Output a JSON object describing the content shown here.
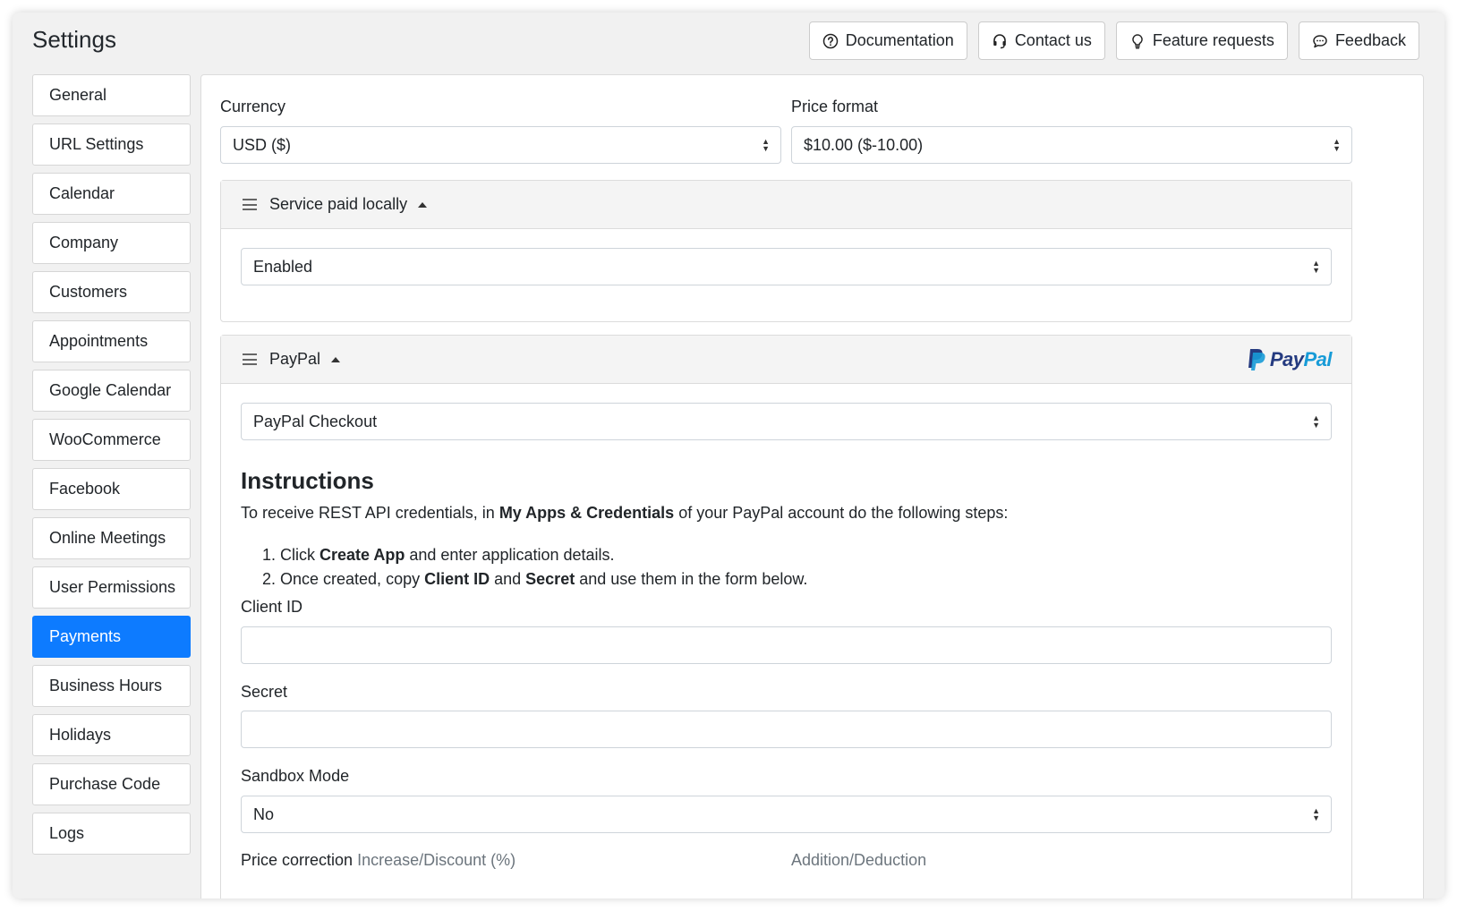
{
  "header": {
    "title": "Settings"
  },
  "top_buttons": [
    {
      "label": "Documentation",
      "icon": "question-circle-icon"
    },
    {
      "label": "Contact us",
      "icon": "headset-icon"
    },
    {
      "label": "Feature requests",
      "icon": "lightbulb-icon"
    },
    {
      "label": "Feedback",
      "icon": "chat-icon"
    }
  ],
  "sidebar": {
    "items": [
      {
        "label": "General"
      },
      {
        "label": "URL Settings"
      },
      {
        "label": "Calendar"
      },
      {
        "label": "Company"
      },
      {
        "label": "Customers"
      },
      {
        "label": "Appointments"
      },
      {
        "label": "Google Calendar"
      },
      {
        "label": "WooCommerce"
      },
      {
        "label": "Facebook"
      },
      {
        "label": "Online Meetings"
      },
      {
        "label": "User Permissions"
      },
      {
        "label": "Payments",
        "active": true
      },
      {
        "label": "Business Hours"
      },
      {
        "label": "Holidays"
      },
      {
        "label": "Purchase Code"
      },
      {
        "label": "Logs"
      }
    ]
  },
  "payments": {
    "currency": {
      "label": "Currency",
      "value": "USD ($)"
    },
    "price_format": {
      "label": "Price format",
      "value": "$10.00 ($-10.00)"
    },
    "local": {
      "title": "Service paid locally",
      "value": "Enabled"
    },
    "paypal": {
      "title": "PayPal",
      "logo_text_pay": "Pay",
      "logo_text_pal": "Pal",
      "method": "PayPal Checkout",
      "instructions_title": "Instructions",
      "instructions_pre": "To receive REST API credentials, in ",
      "instructions_bold": "My Apps & Credentials",
      "instructions_post": " of your PayPal account do the following steps:",
      "steps": [
        {
          "num": "1.",
          "pre": "Click ",
          "bold1": "Create App",
          "mid": " and enter application details.",
          "bold2": "",
          "post": ""
        },
        {
          "num": "2.",
          "pre": "Once created, copy ",
          "bold1": "Client ID",
          "mid": " and ",
          "bold2": "Secret",
          "post": " and use them in the form below."
        }
      ],
      "client_id": {
        "label": "Client ID",
        "value": ""
      },
      "secret": {
        "label": "Secret",
        "value": ""
      },
      "sandbox": {
        "label": "Sandbox Mode",
        "value": "No"
      },
      "price_correction": {
        "label": "Price correction",
        "sub1": "Increase/Discount (%)",
        "sub2": "Addition/Deduction"
      }
    }
  },
  "colors": {
    "accent": "#0d7bff",
    "paypal_dark": "#253b80",
    "paypal_light": "#179bd7"
  }
}
